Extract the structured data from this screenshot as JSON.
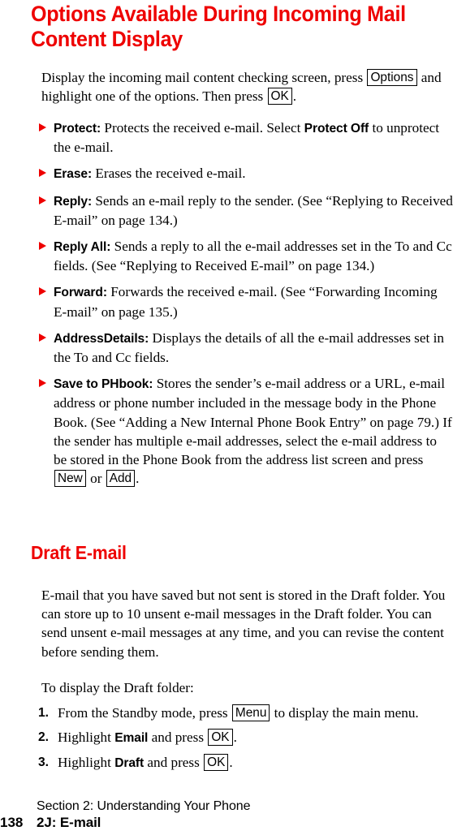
{
  "headings": {
    "main": "Options Available During Incoming Mail Content Display",
    "section": "Draft E-mail"
  },
  "intro": {
    "part1": "Display the incoming mail content checking screen, press",
    "key_options": "Options",
    "part2": "and highlight one of the options. Then press",
    "key_ok": "OK",
    "part3": "."
  },
  "bullets": [
    {
      "label": "Protect:",
      "text_before": "Protects the received e-mail. Select",
      "emphasis": "Protect Off",
      "text_after": "to unprotect the e-mail."
    },
    {
      "label": "Erase:",
      "text_before": "Erases the received e-mail.",
      "emphasis": "",
      "text_after": ""
    },
    {
      "label": "Reply:",
      "text_before": "Sends an e-mail reply to the sender. (See “Replying to Received E-mail” on page 134.)",
      "emphasis": "",
      "text_after": ""
    },
    {
      "label": "Reply All:",
      "text_before": "Sends a reply to all the e-mail addresses set in the To and Cc fields. (See “Replying to Received E-mail” on page 134.)",
      "emphasis": "",
      "text_after": ""
    },
    {
      "label": "Forward:",
      "text_before": "Forwards the received e-mail. (See “Forwarding Incoming E-mail” on page 135.)",
      "emphasis": "",
      "text_after": ""
    },
    {
      "label": "AddressDetails:",
      "text_before": "Displays the details of all the e-mail addresses set in the To and Cc fields.",
      "emphasis": "",
      "text_after": ""
    }
  ],
  "bullet_phbook": {
    "label": "Save to PHbook:",
    "text1": "Stores the sender’s e-mail address or a URL, e-mail address or phone number included in the message body in the Phone Book. (See “Adding a New Internal Phone Book Entry” on page 79.) If the sender has multiple e-mail addresses, select the e-mail address to be stored in the Phone Book from the address list screen and press",
    "key_new": "New",
    "conjunction": "or",
    "key_add": "Add",
    "text2": "."
  },
  "draft_paragraph": "E-mail that you have saved but not sent is stored in the Draft folder. You can store up to 10 unsent e-mail messages in the Draft folder. You can send unsent e-mail messages at any time, and you can revise the content before sending them.",
  "to_display": "To display the Draft folder:",
  "steps": [
    {
      "number": "1.",
      "text_before": "From the Standby mode, press",
      "key": "Menu",
      "text_after": "to display the main menu.",
      "emphasis": ""
    },
    {
      "number": "2.",
      "text_before": "Highlight",
      "emphasis": "Email",
      "text_mid": "and press",
      "key": "OK",
      "text_after": "."
    },
    {
      "number": "3.",
      "text_before": "Highlight",
      "emphasis": "Draft",
      "text_mid": "and press",
      "key": "OK",
      "text_after": "."
    }
  ],
  "footer": {
    "section": "Section 2: Understanding Your Phone",
    "page_number": "138",
    "chapter": "2J: E-mail"
  },
  "colors": {
    "heading_red": "#ee0000",
    "text_black": "#000000",
    "background": "#ffffff"
  }
}
